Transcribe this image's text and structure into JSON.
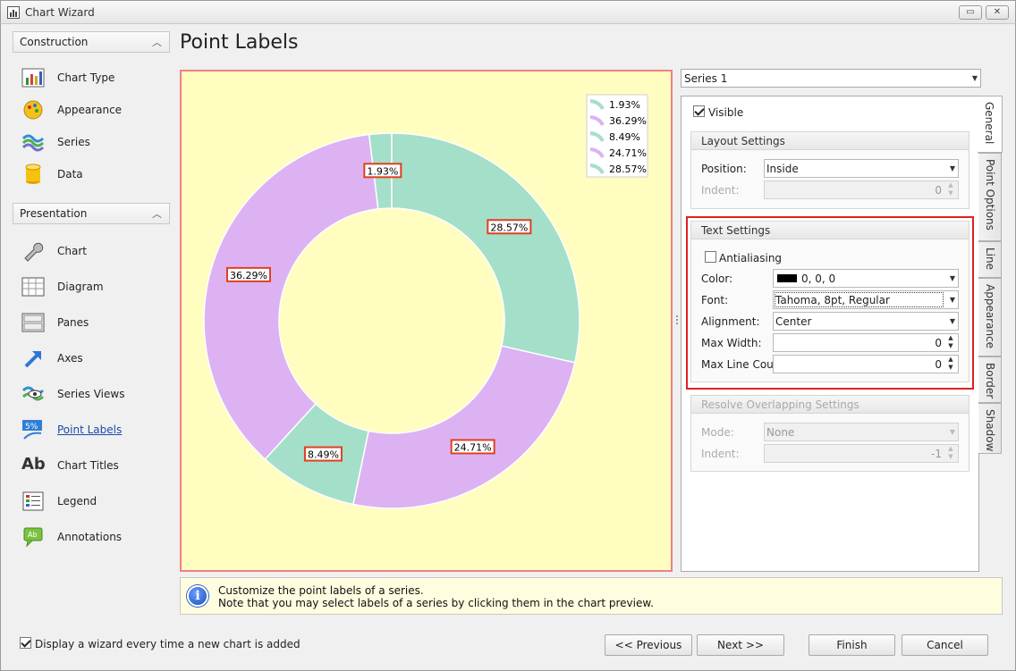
{
  "window": {
    "title": "Chart Wizard"
  },
  "sidebar": {
    "groups": [
      {
        "label": "Construction",
        "items": [
          {
            "label": "Chart Type",
            "icon": "chart-type-icon"
          },
          {
            "label": "Appearance",
            "icon": "appearance-icon"
          },
          {
            "label": "Series",
            "icon": "series-icon"
          },
          {
            "label": "Data",
            "icon": "data-icon"
          }
        ]
      },
      {
        "label": "Presentation",
        "items": [
          {
            "label": "Chart",
            "icon": "wrench-icon"
          },
          {
            "label": "Diagram",
            "icon": "diagram-icon"
          },
          {
            "label": "Panes",
            "icon": "panes-icon"
          },
          {
            "label": "Axes",
            "icon": "axes-icon"
          },
          {
            "label": "Series Views",
            "icon": "series-views-icon"
          },
          {
            "label": "Point Labels",
            "icon": "point-labels-icon"
          },
          {
            "label": "Chart Titles",
            "icon": "chart-titles-icon"
          },
          {
            "label": "Legend",
            "icon": "legend-icon"
          },
          {
            "label": "Annotations",
            "icon": "annotations-icon"
          }
        ]
      }
    ],
    "active": "Point Labels",
    "point_labels_icon_text": "5%",
    "chart_titles_icon_text": "Ab",
    "annotations_icon_text": "Ab"
  },
  "page": {
    "title": "Point Labels"
  },
  "chart_data": {
    "type": "pie",
    "variant": "doughnut",
    "labels": [
      "1.93%",
      "36.29%",
      "8.49%",
      "24.71%",
      "28.57%"
    ],
    "values": [
      1.93,
      36.29,
      8.49,
      24.71,
      28.57
    ],
    "colors": [
      "#a4dfca",
      "#ddb2f3",
      "#a4dfca",
      "#ddb2f3",
      "#a4dfca"
    ],
    "legend_position": "top-right",
    "background": "#fffdc0",
    "border_color": "#f08080",
    "label_border_color": "#e0401f"
  },
  "series_selector": {
    "value": "Series 1"
  },
  "tabs": [
    "General",
    "Point Options",
    "Line",
    "Appearance",
    "Border",
    "Shadow"
  ],
  "general": {
    "visible_label": "Visible",
    "visible_checked": true,
    "layout": {
      "header": "Layout Settings",
      "position_label": "Position:",
      "position_value": "Inside",
      "indent_label": "Indent:",
      "indent_value": "0"
    },
    "text": {
      "header": "Text Settings",
      "antialiasing_label": "Antialiasing",
      "antialiasing_checked": false,
      "color_label": "Color:",
      "color_value": "0, 0, 0",
      "color_swatch": "#000000",
      "font_label": "Font:",
      "font_value": "Tahoma, 8pt, Regular",
      "alignment_label": "Alignment:",
      "alignment_value": "Center",
      "max_width_label": "Max Width:",
      "max_width_value": "0",
      "max_line_count_label": "Max Line Count:",
      "max_line_count_value": "0"
    },
    "overlap": {
      "header": "Resolve Overlapping Settings",
      "mode_label": "Mode:",
      "mode_value": "None",
      "indent_label": "Indent:",
      "indent_value": "-1"
    }
  },
  "info": {
    "line1": "Customize the point labels of a series.",
    "line2": "Note that you may select labels of a series by clicking them in the chart preview."
  },
  "footer": {
    "show_wizard_label": "Display a wizard every time a new chart is added",
    "show_wizard_checked": true,
    "previous": "<< Previous",
    "next": "Next >>",
    "finish": "Finish",
    "cancel": "Cancel"
  },
  "colors": {
    "highlight": "#e02020",
    "link": "#1a4aa8"
  }
}
